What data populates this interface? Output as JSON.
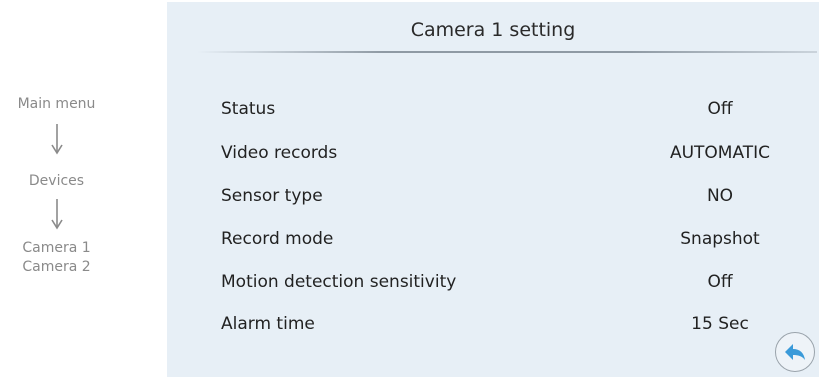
{
  "breadcrumb": {
    "items": [
      "Main menu",
      "Devices",
      "Camera 1",
      "Camera 2"
    ]
  },
  "panel": {
    "title": "Camera 1 setting",
    "rows": [
      {
        "label": "Status",
        "value": "Off"
      },
      {
        "label": "Video records",
        "value": "AUTOMATIC"
      },
      {
        "label": "Sensor type",
        "value": "NO"
      },
      {
        "label": "Record mode",
        "value": "Snapshot"
      },
      {
        "label": "Motion detection sensitivity",
        "value": "Off"
      },
      {
        "label": "Alarm time",
        "value": "15 Sec"
      }
    ]
  },
  "back_button": {
    "icon": "back-arrow-icon",
    "color": "#3a9ad9"
  }
}
